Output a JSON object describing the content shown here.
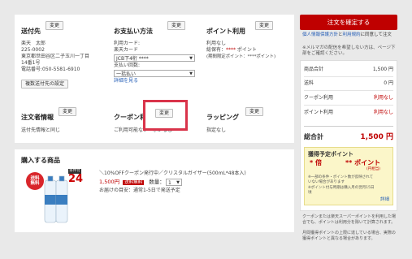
{
  "shipping": {
    "title": "送付先",
    "change": "変更",
    "lines": [
      "楽天　太郎",
      "225-0002",
      "東京都世田谷区二子玉川一丁目",
      "14番1号",
      "電話番号:050-5581-6910"
    ],
    "multi_button": "複数送付先の設定"
  },
  "payment": {
    "title": "お支払い方法",
    "change": "変更",
    "card_label": "利用カード:",
    "card_type": "楽天カード",
    "card_select": "JCB下4桁 ****",
    "count_label": "支払い回数:",
    "count_select": "一括払い",
    "detail_link": "詳細を見る"
  },
  "points": {
    "title": "ポイント利用",
    "change": "変更",
    "usage": "利用なし",
    "owned_label": "総保有：",
    "owned_stars": "****",
    "owned_unit": " ポイント",
    "period_line": "(期間限定ポイント：****ポイント)"
  },
  "orderer": {
    "title": "注文者情報",
    "change": "変更",
    "text": "送付先情報と同じ"
  },
  "coupon": {
    "title": "クーポン利用",
    "change": "変更",
    "text": "ご利用可能なクーポンなし"
  },
  "wrapping": {
    "title": "ラッピング",
    "change": "変更",
    "text": "指定なし"
  },
  "product": {
    "section_title": "購入する商品",
    "badge_top": "送料",
    "badge_bottom": "無料",
    "tag_top": "条件付",
    "tag_num": "24",
    "name": "＼10%OFFクーポン発行中／クリスタルガイザー(500mL*48本入)",
    "price": "1,500円",
    "free_ship": "送料無料",
    "qty_label": "数量：",
    "qty": "1",
    "delivery": "お届けの目安：通常1-5日で発送予定"
  },
  "sidebar": {
    "confirm": "注文を確定する",
    "agree_link": "個人情報保護方針",
    "agree_text_a": "と",
    "agree_link2": "利用規約",
    "agree_text_b": "に同意して注文",
    "note": "※メルマガの配信を希望しない方は、ページ下部をご確認ください。",
    "rows": [
      {
        "label": "商品合計",
        "value": "1,500 円",
        "red": false
      },
      {
        "label": "送料",
        "value": "0 円",
        "red": false
      },
      {
        "label": "クーポン利用",
        "value": "利用なし",
        "red": true
      },
      {
        "label": "ポイント利用",
        "value": "利用なし",
        "red": true
      }
    ],
    "total_label": "総合計",
    "total_value": "1,500 円",
    "earn_title": "獲得予定ポイント",
    "earn_mult": "* 倍",
    "earn_pts": "** ポイント",
    "earn_unit": "(円相当)",
    "earn_notes": [
      "※一部の条件・ポイント数が反映されていない場合があります",
      "※ポイント付与時期は購入月の翌月15日頃"
    ],
    "detail": "詳細",
    "bottom_text_a": "クーポンまたは楽天スーパーポイントを利用した場合でも、ポイントは利用分を除いて計算されます。",
    "bottom_text_b": "月間獲得ポイントの上限に達している場合、実際の獲得ポイントと異なる場合があります。"
  }
}
